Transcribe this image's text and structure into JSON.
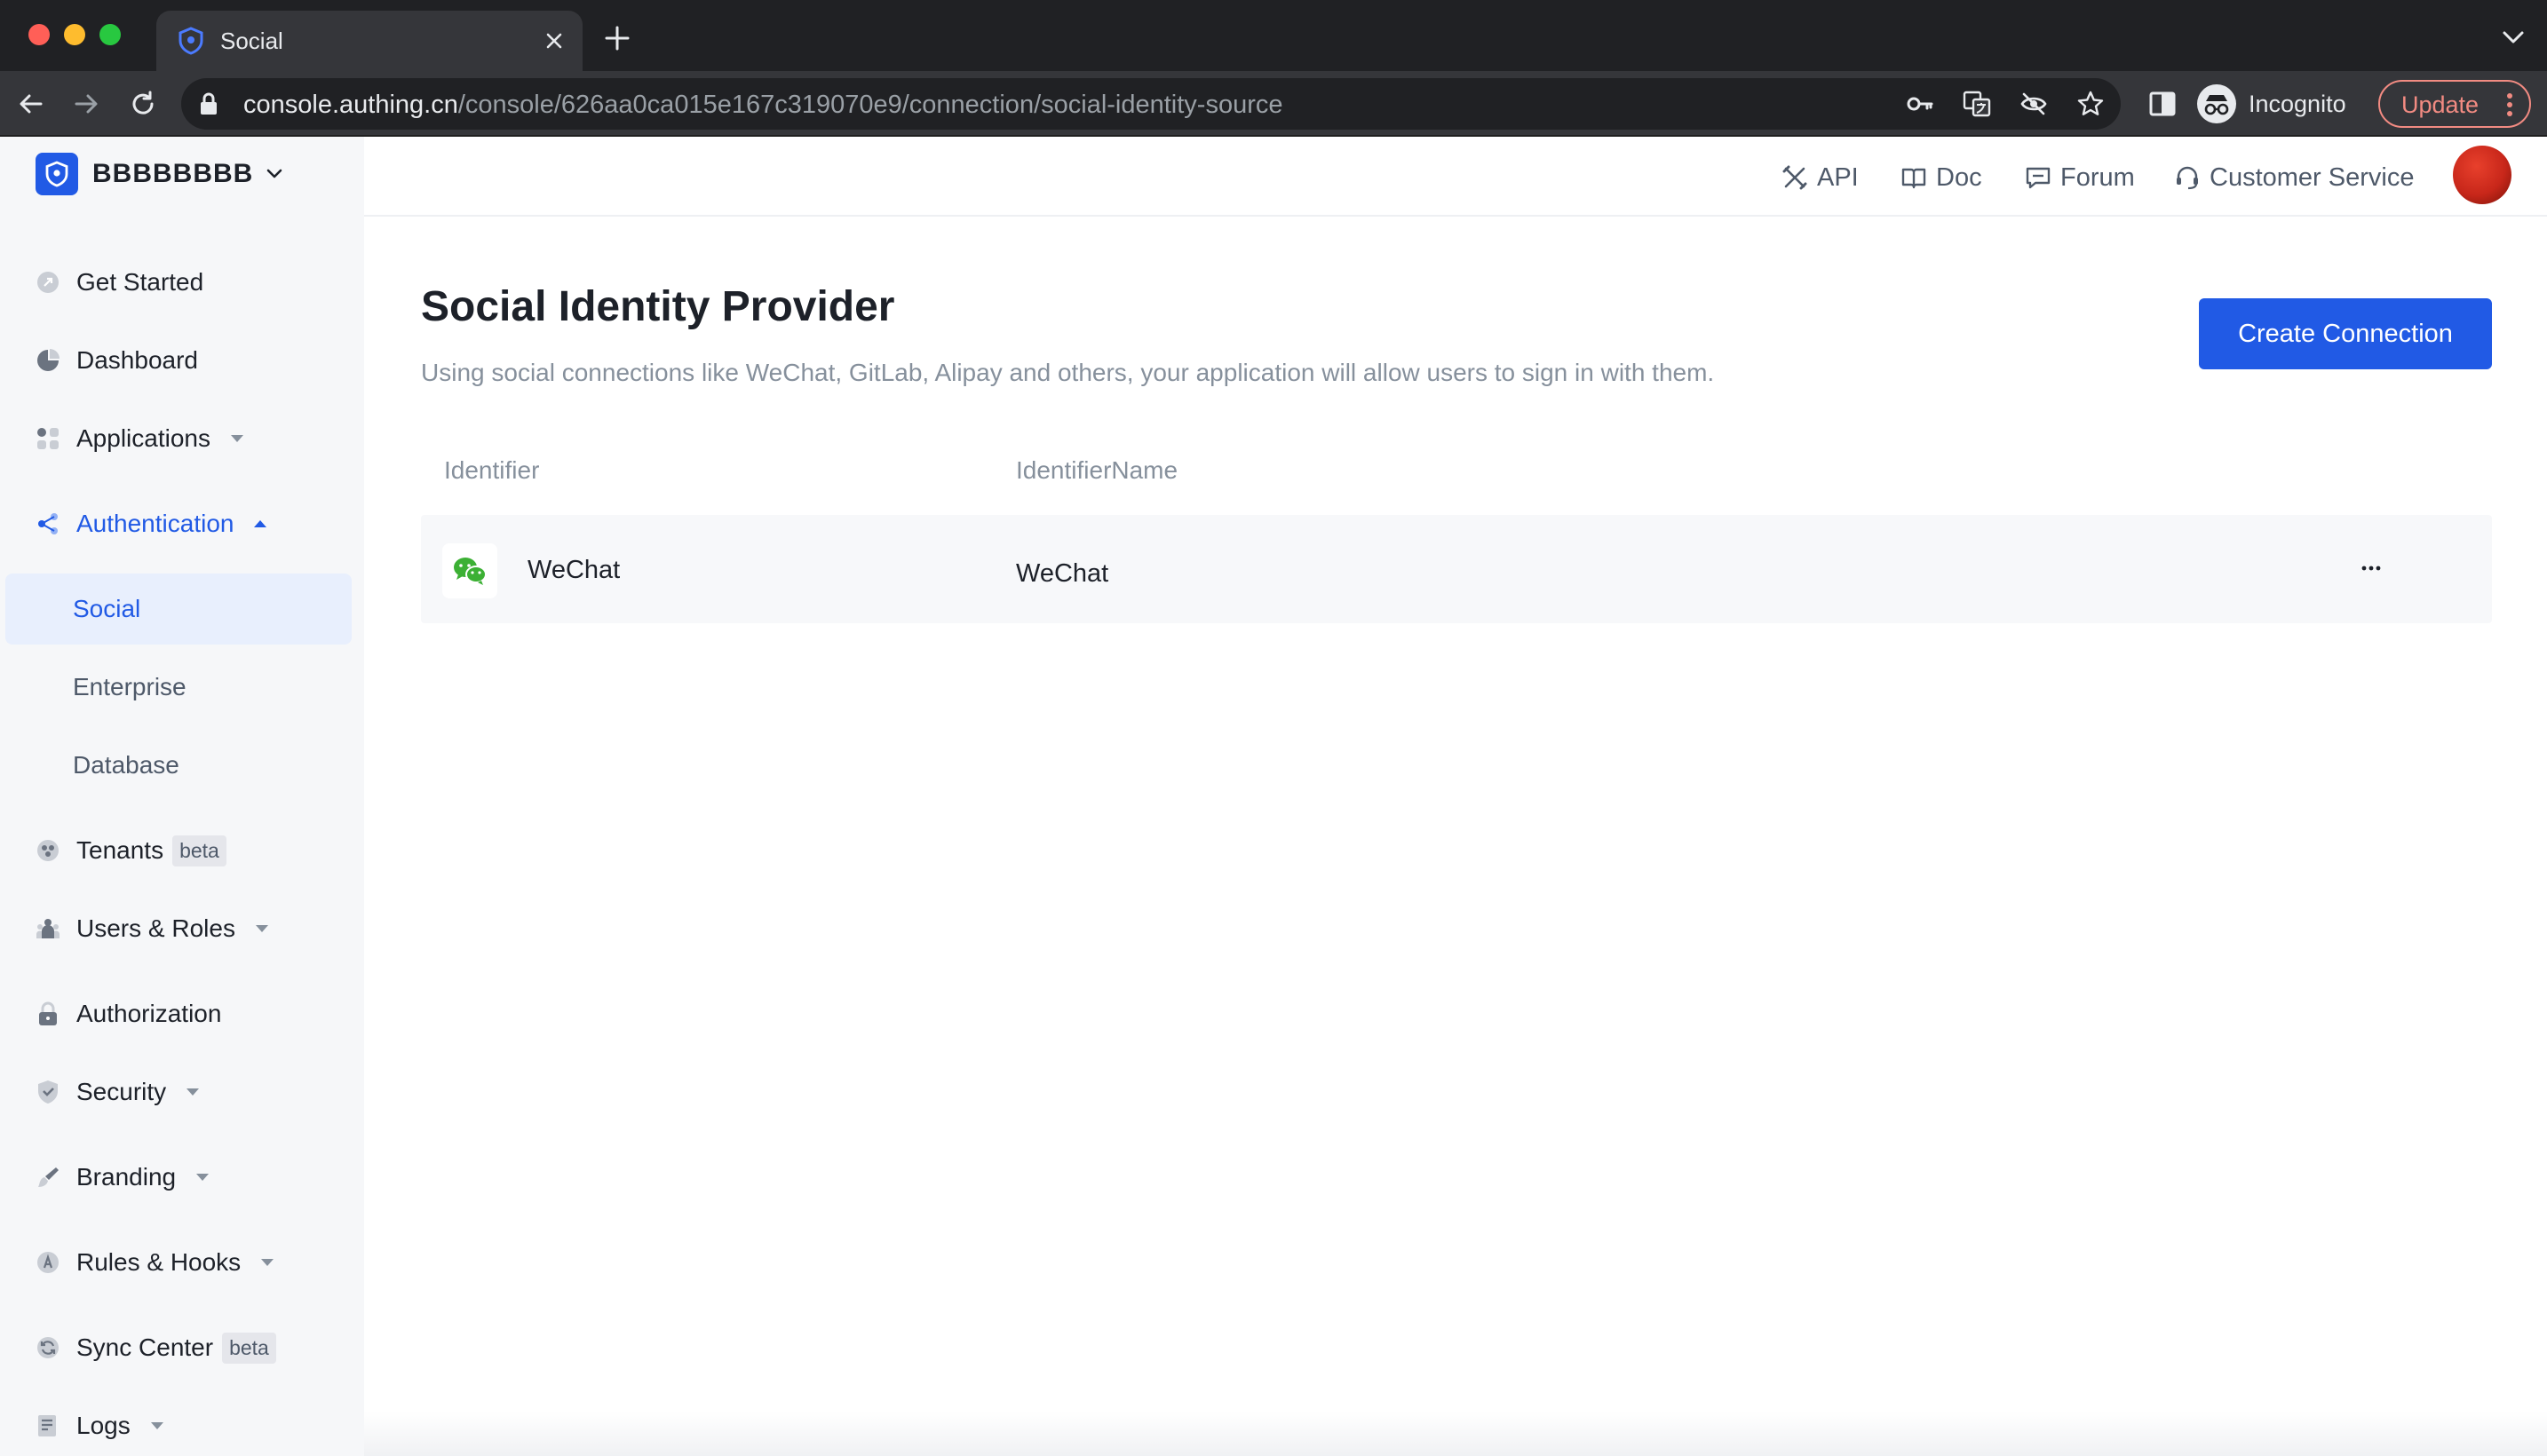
{
  "browser": {
    "tab_title": "Social",
    "url_host": "console.authing.cn",
    "url_path": "/console/626aa0ca015e167c319070e9/connection/social-identity-source",
    "incognito_label": "Incognito",
    "update_label": "Update"
  },
  "sidebar": {
    "org_name": "BBBBBBBB",
    "items": [
      {
        "label": "Get Started",
        "icon": "rocket-icon"
      },
      {
        "label": "Dashboard",
        "icon": "pie-chart-icon"
      },
      {
        "label": "Applications",
        "icon": "apps-grid-icon"
      },
      {
        "label": "Authentication",
        "icon": "share-icon"
      },
      {
        "label": "Tenants",
        "icon": "tenants-icon",
        "badge": "beta"
      },
      {
        "label": "Users & Roles",
        "icon": "users-icon"
      },
      {
        "label": "Authorization",
        "icon": "lock-icon"
      },
      {
        "label": "Security",
        "icon": "shield-icon"
      },
      {
        "label": "Branding",
        "icon": "brush-icon"
      },
      {
        "label": "Rules & Hooks",
        "icon": "hook-icon"
      },
      {
        "label": "Sync Center",
        "icon": "sync-icon",
        "badge": "beta"
      },
      {
        "label": "Logs",
        "icon": "logs-icon"
      }
    ],
    "auth_subitems": [
      {
        "label": "Social"
      },
      {
        "label": "Enterprise"
      },
      {
        "label": "Database"
      }
    ]
  },
  "header": {
    "links": [
      {
        "label": "API",
        "icon": "tools-icon"
      },
      {
        "label": "Doc",
        "icon": "book-icon"
      },
      {
        "label": "Forum",
        "icon": "chat-icon"
      },
      {
        "label": "Customer Service",
        "icon": "headset-icon"
      }
    ]
  },
  "main": {
    "title": "Social Identity Provider",
    "description": "Using social connections like WeChat, GitLab, Alipay and others, your application will allow users to sign in with them.",
    "create_button": "Create Connection",
    "columns": [
      "Identifier",
      "IdentifierName"
    ],
    "rows": [
      {
        "identifier": "WeChat",
        "identifier_name": "WeChat",
        "icon": "wechat-icon"
      }
    ]
  },
  "colors": {
    "accent": "#215ae5",
    "sidebar_bg": "#f6f7f9",
    "wechat_green": "#3cb034"
  }
}
